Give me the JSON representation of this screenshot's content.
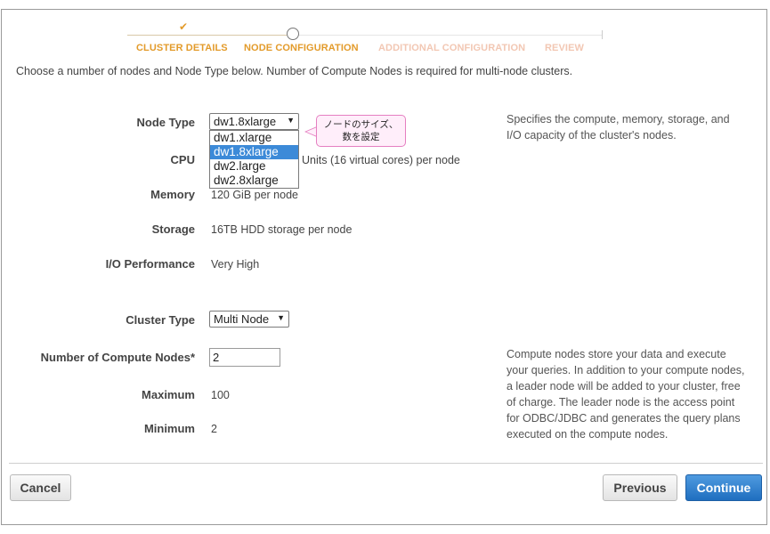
{
  "wizard": {
    "steps": [
      {
        "label": "CLUSTER DETAILS",
        "state": "done"
      },
      {
        "label": "NODE CONFIGURATION",
        "state": "active"
      },
      {
        "label": "ADDITIONAL CONFIGURATION",
        "state": "future"
      },
      {
        "label": "REVIEW",
        "state": "future"
      }
    ],
    "done_icon": "check-icon",
    "active_icon": "circle-icon"
  },
  "intro": "Choose a number of nodes and Node Type below. Number of Compute Nodes is required for multi-node clusters.",
  "node_type": {
    "label": "Node Type",
    "selected": "dw1.8xlarge",
    "options": [
      "dw1.xlarge",
      "dw1.8xlarge",
      "dw2.large",
      "dw2.8xlarge"
    ],
    "help": [
      "Specifies the compute, memory, storage, and",
      "I/O capacity of the cluster's nodes."
    ]
  },
  "annotation": {
    "line1": "ノードのサイズ、",
    "line2": "数を設定"
  },
  "specs": {
    "cpu_label": "CPU",
    "cpu_value": "Units (16 virtual cores) per node",
    "memory_label": "Memory",
    "memory_value": "120 GiB per node",
    "storage_label": "Storage",
    "storage_value": "16TB HDD storage per node",
    "io_label": "I/O Performance",
    "io_value": "Very High"
  },
  "cluster_type": {
    "label": "Cluster Type",
    "selected": "Multi Node"
  },
  "compute_nodes": {
    "label": "Number of Compute Nodes*",
    "value": "2",
    "max_label": "Maximum",
    "max_value": "100",
    "min_label": "Minimum",
    "min_value": "2",
    "help": [
      "Compute nodes store your data and execute",
      "your queries. In addition to your compute nodes,",
      "a leader node will be added to your cluster, free",
      "of charge. The leader node is the access point",
      "for ODBC/JDBC and generates the query plans",
      "executed on the compute nodes."
    ]
  },
  "footer": {
    "cancel": "Cancel",
    "previous": "Previous",
    "continue": "Continue"
  },
  "colors": {
    "accent": "#e39b2b",
    "primary": "#1f6ebf",
    "highlight": "#3c8ad8"
  }
}
